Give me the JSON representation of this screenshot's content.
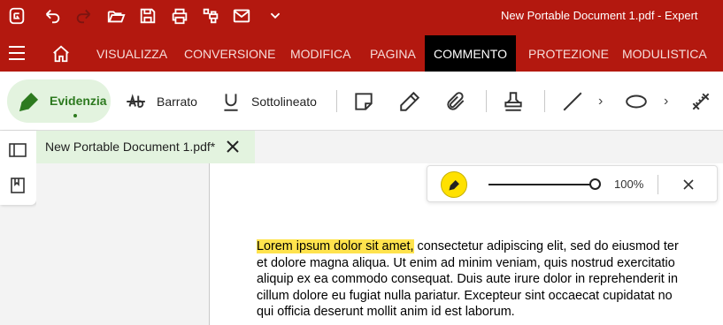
{
  "titlebar": {
    "document_title": "New Portable Document 1.pdf   -   Expert",
    "icons": [
      "app-logo-icon",
      "undo-icon",
      "redo-icon",
      "open-folder-icon",
      "save-icon",
      "print-icon",
      "batch-print-icon",
      "mail-icon",
      "more-chevron-icon"
    ]
  },
  "menubar": {
    "items": [
      "VISUALIZZA",
      "CONVERSIONE",
      "MODIFICA",
      "PAGINA",
      "COMMENTO",
      "PROTEZIONE",
      "MODULISTICA"
    ],
    "active": "COMMENTO"
  },
  "toolbar": {
    "highlight_label": "Evidenzia",
    "strikethrough_label": "Barrato",
    "underline_label": "Sottolineato",
    "highlight_color": "#2d7a1f"
  },
  "tab": {
    "title": "New Portable Document 1.pdf*"
  },
  "floatbar": {
    "color": "#ffe100",
    "opacity": "100%",
    "opacity_value": 1.0
  },
  "document": {
    "highlighted": "Lorem ipsum dolor sit amet,",
    "line1_rest": " consectetur adipiscing elit, sed do eiusmod ter",
    "line2": "et dolore magna aliqua. Ut enim ad minim veniam, quis nostrud exercitatio",
    "line3": "aliquip ex ea commodo consequat. Duis aute irure dolor in reprehenderit in",
    "line4": "cillum dolore eu fugiat nulla pariatur. Excepteur sint occaecat cupidatat no",
    "line5": "qui officia deserunt mollit anim id est laborum."
  },
  "colors": {
    "brand_red": "#b3180f",
    "active_tab": "#000000",
    "highlight_yellow": "#ffe34d"
  }
}
